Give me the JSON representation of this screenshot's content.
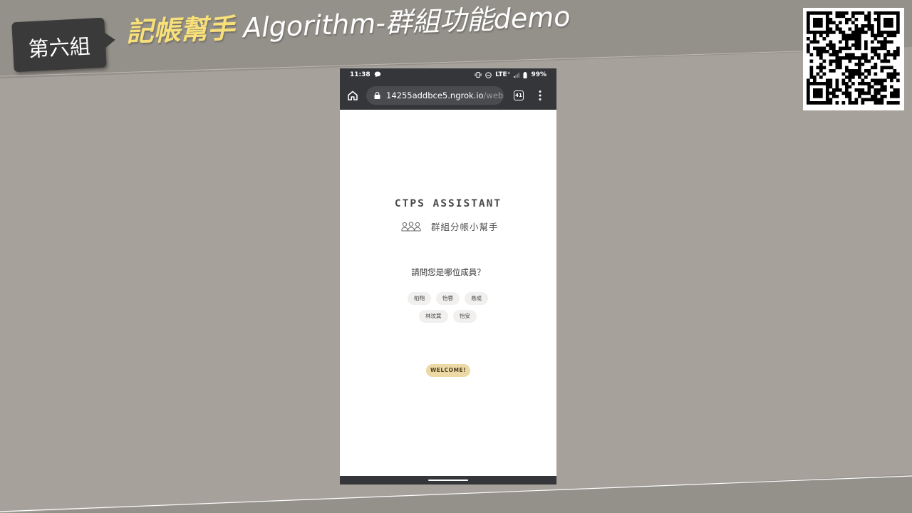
{
  "slide": {
    "group_label": "第六組",
    "title_highlight": "記帳幫手",
    "title_rest": " Algorithm-群組功能demo"
  },
  "status_bar": {
    "time": "11:38",
    "network": "LTE⁺",
    "battery": "99%"
  },
  "browser": {
    "url_domain": "14255addbce5.ngrok.io",
    "url_path": "/web",
    "tab_count": "41"
  },
  "app": {
    "brand": "CTPS ASSISTANT",
    "subtitle": "群組分帳小幫手",
    "question": "請問您是哪位成員？",
    "members": [
      "柏翔",
      "怡蓉",
      "易成",
      "林玟萁",
      "怡安"
    ],
    "welcome_button": "WELCOME!"
  },
  "colors": {
    "title_highlight": "#f7e07a",
    "welcome_button": "#ecd9a6",
    "browser_chrome": "#35363a"
  }
}
